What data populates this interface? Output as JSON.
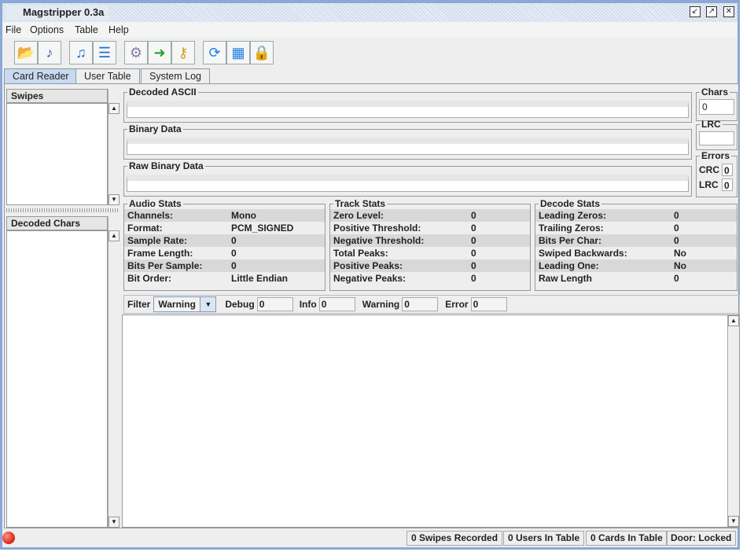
{
  "window": {
    "title": "Magstripper 0.3a"
  },
  "menu": [
    "File",
    "Options",
    "Table",
    "Help"
  ],
  "toolbar": [
    {
      "icon": "open-folder-icon"
    },
    {
      "icon": "audio-file-icon"
    },
    {
      "icon": "audio-document-icon"
    },
    {
      "icon": "document-icon"
    },
    {
      "icon": "gear-icon"
    },
    {
      "icon": "export-icon"
    },
    {
      "icon": "key-icon"
    },
    {
      "icon": "refresh-icon"
    },
    {
      "icon": "grid-icon"
    },
    {
      "icon": "lock-screen-icon"
    }
  ],
  "tabs": [
    "Card Reader",
    "User Table",
    "System Log"
  ],
  "left": {
    "swipes": "Swipes",
    "decoded_chars": "Decoded Chars"
  },
  "fields": {
    "decoded_ascii": "Decoded ASCII",
    "binary": "Binary Data",
    "raw_binary": "Raw Binary Data",
    "chars": "Chars",
    "chars_value": "0",
    "lrc": "LRC",
    "errors": "Errors",
    "crc_label": "CRC",
    "crc_value": "0",
    "lrc_label": "LRC",
    "lrc_value": "0"
  },
  "audio_stats": {
    "title": "Audio Stats",
    "rows": [
      [
        "Channels:",
        "Mono"
      ],
      [
        "Format:",
        "PCM_SIGNED"
      ],
      [
        "Sample Rate:",
        "0"
      ],
      [
        "Frame Length:",
        "0"
      ],
      [
        "Bits Per Sample:",
        "0"
      ],
      [
        "Bit Order:",
        "Little Endian"
      ]
    ]
  },
  "track_stats": {
    "title": "Track Stats",
    "rows": [
      [
        "Zero Level:",
        "0"
      ],
      [
        "Positive Threshold:",
        "0"
      ],
      [
        "Negative Threshold:",
        "0"
      ],
      [
        "Total Peaks:",
        "0"
      ],
      [
        "Positive Peaks:",
        "0"
      ],
      [
        "Negative Peaks:",
        "0"
      ]
    ]
  },
  "decode_stats": {
    "title": "Decode Stats",
    "rows": [
      [
        "Leading Zeros:",
        "0"
      ],
      [
        "Trailing Zeros:",
        "0"
      ],
      [
        "Bits Per Char:",
        "0"
      ],
      [
        "Swiped Backwards:",
        "No"
      ],
      [
        "Leading One:",
        "No"
      ],
      [
        "Raw Length",
        "0"
      ]
    ]
  },
  "filter": {
    "label": "Filter",
    "selected": "Warning",
    "debug_label": "Debug",
    "debug": "0",
    "info_label": "Info",
    "info": "0",
    "warning_label": "Warning",
    "warning": "0",
    "error_label": "Error",
    "error": "0"
  },
  "status": {
    "swipes": "0 Swipes Recorded",
    "users": "0 Users In Table",
    "cards": "0 Cards In Table",
    "door": "Door: Locked",
    "indicator_color": "#e03020"
  }
}
